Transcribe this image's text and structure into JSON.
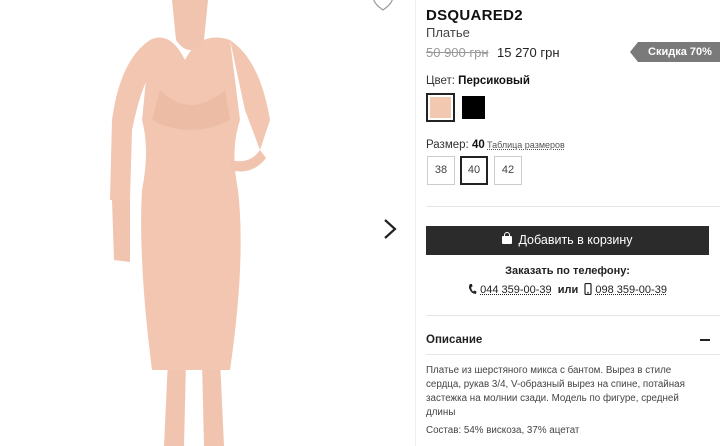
{
  "product": {
    "brand": "DSQUARED2",
    "type": "Платье",
    "price_old": "50 900 грн",
    "price_new": "15 270 грн",
    "discount": "Скидка 70%"
  },
  "color": {
    "label": "Цвет:",
    "selected": "Персиковый",
    "swatches": [
      "#f2c8b0",
      "#000000"
    ]
  },
  "size": {
    "label": "Размер:",
    "selected": "40",
    "table_link": "Таблица размеров",
    "options": [
      "38",
      "40",
      "42"
    ]
  },
  "cart": {
    "add_label": "Добавить в корзину"
  },
  "phone": {
    "title": "Заказать по телефону:",
    "phone1": "044 359-00-39",
    "or": "или",
    "phone2": "098 359-00-39"
  },
  "description": {
    "title": "Описание",
    "text": "Платье из шерстяного микса с бантом. Вырез в стиле сердца, рукав 3/4, V-образный вырез на спине, потайная застежка на молнии сзади. Модель по фигуре, средней длины",
    "composition": "Состав: 54% вискоза, 37% ацетат"
  },
  "icons": {
    "favorite": "heart-icon",
    "next": "chevron-right-icon",
    "cart": "bag-icon",
    "phone": "phone-icon",
    "mobile": "mobile-phone-icon",
    "toggle": "minus-icon"
  },
  "colors": {
    "accent_dark": "#2b2b2b",
    "badge": "#7a7a7a",
    "dress": "#f2c8b0"
  }
}
